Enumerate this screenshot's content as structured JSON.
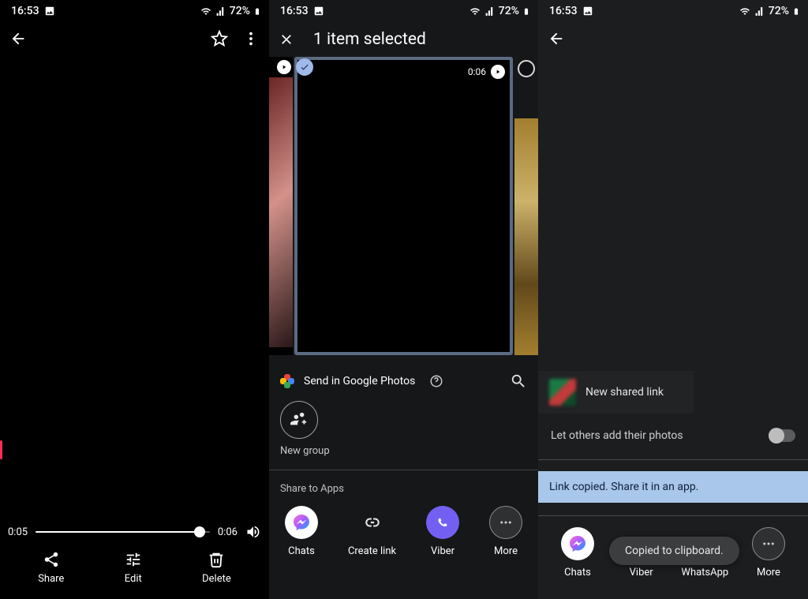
{
  "status": {
    "time": "16:53",
    "battery": "72%"
  },
  "panel1": {
    "progress": {
      "current": "0:05",
      "total": "0:06"
    },
    "actions": {
      "share": "Share",
      "edit": "Edit",
      "delete": "Delete"
    }
  },
  "panel2": {
    "title": "1 item selected",
    "thumb_time": "0:06",
    "send": "Send in Google Photos",
    "new_group": "New group",
    "share_to_apps": "Share to Apps",
    "apps": {
      "chats": "Chats",
      "create_link": "Create link",
      "viber": "Viber",
      "more": "More"
    }
  },
  "panel3": {
    "shared_link": "New shared link",
    "toggle_label": "Let others add their photos",
    "banner": "Link copied. Share it in an app.",
    "apps": {
      "chats": "Chats",
      "viber": "Viber",
      "whatsapp": "WhatsApp",
      "more": "More"
    },
    "toast": "Copied to clipboard."
  }
}
